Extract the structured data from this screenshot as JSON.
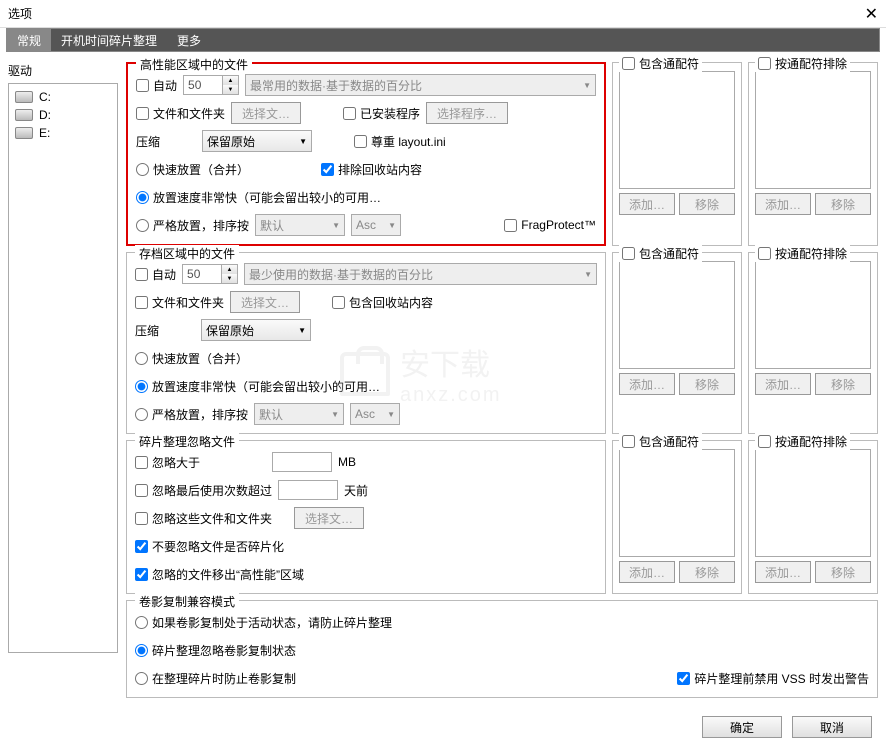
{
  "window": {
    "title": "选项",
    "close": "✕"
  },
  "tabs": [
    {
      "label": "常规",
      "active": true
    },
    {
      "label": "开机时间碎片整理",
      "active": false
    },
    {
      "label": "更多",
      "active": false
    }
  ],
  "drives": {
    "label": "驱动",
    "items": [
      "C:",
      "D:",
      "E:"
    ]
  },
  "sections": {
    "highPerf": {
      "title": "高性能区域中的文件",
      "auto": "自动",
      "spin": "50",
      "dataSelect": "最常用的数据·基于数据的百分比",
      "filesFolders": "文件和文件夹",
      "selectFiles": "选择文…",
      "installedPrograms": "已安装程序",
      "selectPrograms": "选择程序…",
      "compress": "压缩",
      "compressSelect": "保留原始",
      "respectLayout": "尊重 layout.ini",
      "fastPlace": "快速放置（合并）",
      "excludeRecycle": "排除回收站内容",
      "veryFast": "放置速度非常快（可能会留出较小的可用…",
      "strictPlace": "严格放置，排序按",
      "sortSelect": "默认",
      "sortDir": "Asc",
      "fragProtect": "FragProtect™"
    },
    "archive": {
      "title": "存档区域中的文件",
      "auto": "自动",
      "spin": "50",
      "dataSelect": "最少使用的数据·基于数据的百分比",
      "filesFolders": "文件和文件夹",
      "selectFiles": "选择文…",
      "includeRecycle": "包含回收站内容",
      "compress": "压缩",
      "compressSelect": "保留原始",
      "fastPlace": "快速放置（合并）",
      "veryFast": "放置速度非常快（可能会留出较小的可用…",
      "strictPlace": "严格放置，排序按",
      "sortSelect": "默认",
      "sortDir": "Asc"
    },
    "ignore": {
      "title": "碎片整理忽略文件",
      "ignoreLarger": "忽略大于",
      "mb": "MB",
      "ignoreLastUse": "忽略最后使用次数超过",
      "daysAgo": "天前",
      "ignoreThese": "忽略这些文件和文件夹",
      "selectFiles": "选择文…",
      "notIgnoreFrag": "不要忽略文件是否碎片化",
      "moveIgnored": "忽略的文件移出“高性能”区域"
    },
    "volume": {
      "title": "卷影复制兼容模式",
      "opt1": "如果卷影复制处于活动状态，请防止碎片整理",
      "opt2": "碎片整理忽略卷影复制状态",
      "opt3": "在整理碎片时防止卷影复制",
      "warn": "碎片整理前禁用 VSS 时发出警告"
    }
  },
  "side": {
    "includeWildcard": "包含通配符",
    "excludeWildcard": "按通配符排除",
    "add": "添加…",
    "remove": "移除"
  },
  "footer": {
    "ok": "确定",
    "cancel": "取消"
  },
  "watermark": {
    "text1": "安下载",
    "text2": "anxz.com"
  }
}
